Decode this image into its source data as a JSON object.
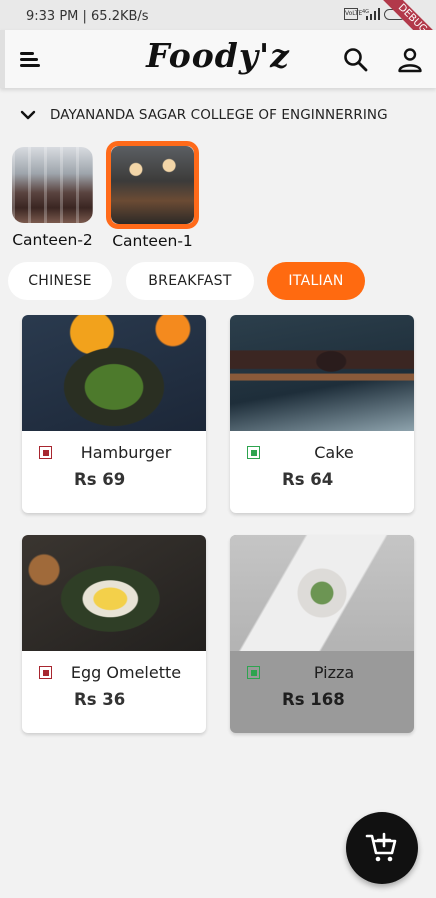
{
  "status_bar": {
    "time_speed": "9:33 PM | 65.2KB/s",
    "volte_label": "VoLTE",
    "network_label": "4G",
    "debug_label": "DEBUG"
  },
  "app_bar": {
    "title": "Foody'z",
    "menu_icon": "menu-icon",
    "search_icon": "search-icon",
    "profile_icon": "person-icon"
  },
  "location": {
    "name": "DAYANANDA SAGAR COLLEGE OF ENGINNERRING"
  },
  "canteens": [
    {
      "label": "Canteen-2",
      "selected": false
    },
    {
      "label": "Canteen-1",
      "selected": true
    }
  ],
  "categories": [
    {
      "label": "CHINESE",
      "active": false
    },
    {
      "label": "BREAKFAST",
      "active": false
    },
    {
      "label": "ITALIAN",
      "active": true
    }
  ],
  "foods": [
    {
      "name": "Hamburger",
      "price": "Rs 69",
      "type": "non-veg",
      "available": true
    },
    {
      "name": "Cake",
      "price": "Rs 64",
      "type": "veg",
      "available": true
    },
    {
      "name": "Egg Omelette",
      "price": "Rs 36",
      "type": "non-veg",
      "available": true
    },
    {
      "name": "Pizza",
      "price": "Rs 168",
      "type": "veg",
      "available": false
    }
  ],
  "fab": {
    "icon": "add-to-cart-icon"
  },
  "colors": {
    "accent": "#ff6a10",
    "background": "#f2f2f2",
    "nonveg": "#a8262f",
    "veg": "#2ea44f",
    "fab": "#111111"
  }
}
